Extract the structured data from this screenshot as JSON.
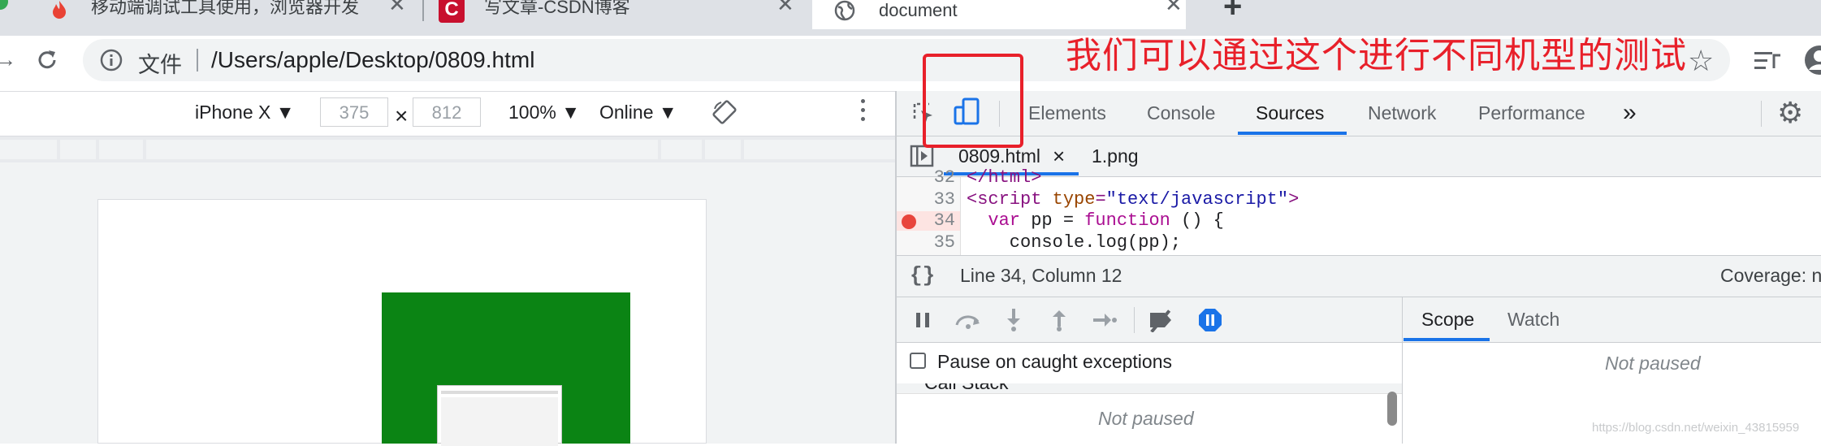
{
  "browser": {
    "tabs": [
      {
        "title": "移动端调试工具使用，浏览器开发",
        "icon": "flame-icon",
        "active": false
      },
      {
        "title": "写文章-CSDN博客",
        "icon": "csdn-logo-icon",
        "active": false
      },
      {
        "title": "document",
        "icon": "globe-icon",
        "active": true
      }
    ],
    "new_tab_symbol": "+",
    "address": {
      "security_label": "文件",
      "url": "/Users/apple/Desktop/0809.html"
    }
  },
  "device_toolbar": {
    "device": "iPhone X ▼",
    "width": "375",
    "times": "×",
    "height": "812",
    "zoom": "100% ▼",
    "network": "Online ▼"
  },
  "devtools": {
    "panels": [
      "Elements",
      "Console",
      "Sources",
      "Network",
      "Performance"
    ],
    "overflow": "»",
    "active_panel": "Sources",
    "file_tabs": [
      {
        "name": "0809.html",
        "close": "×"
      },
      {
        "name": "1.png"
      }
    ],
    "code": {
      "lines": [
        {
          "no": "32",
          "text": "</html>"
        },
        {
          "no": "33",
          "p1": "<script ",
          "p2": "type",
          "p3": "=",
          "p4": "\"text/javascript\"",
          "p5": ">"
        },
        {
          "no": "34",
          "p1": "  ",
          "p2": "var",
          "p3": " pp = ",
          "p4": "function",
          "p5": " () {",
          "breakpoint": true
        },
        {
          "no": "35",
          "text": "    console.log(pp);"
        }
      ]
    },
    "status": {
      "format_symbol": "{}",
      "position": "Line 34, Column 12",
      "coverage": "Coverage: n/a"
    },
    "debugger": {
      "pause_on_caught": "Pause on caught exceptions",
      "call_stack_label": "Call Stack",
      "call_stack_status": "Not paused"
    },
    "sidebar": {
      "tabs": [
        "Scope",
        "Watch"
      ],
      "active_tab": "Scope",
      "status": "Not paused"
    }
  },
  "annotation": {
    "text": "我们可以通过这个进行不同机型的测试",
    "color": "#e8202a"
  },
  "watermark": "https://blog.csdn.net/weixin_43815959",
  "colors": {
    "accent": "#1a73e8",
    "page_green": "#0b8414",
    "breakpoint": "#e8453c"
  }
}
